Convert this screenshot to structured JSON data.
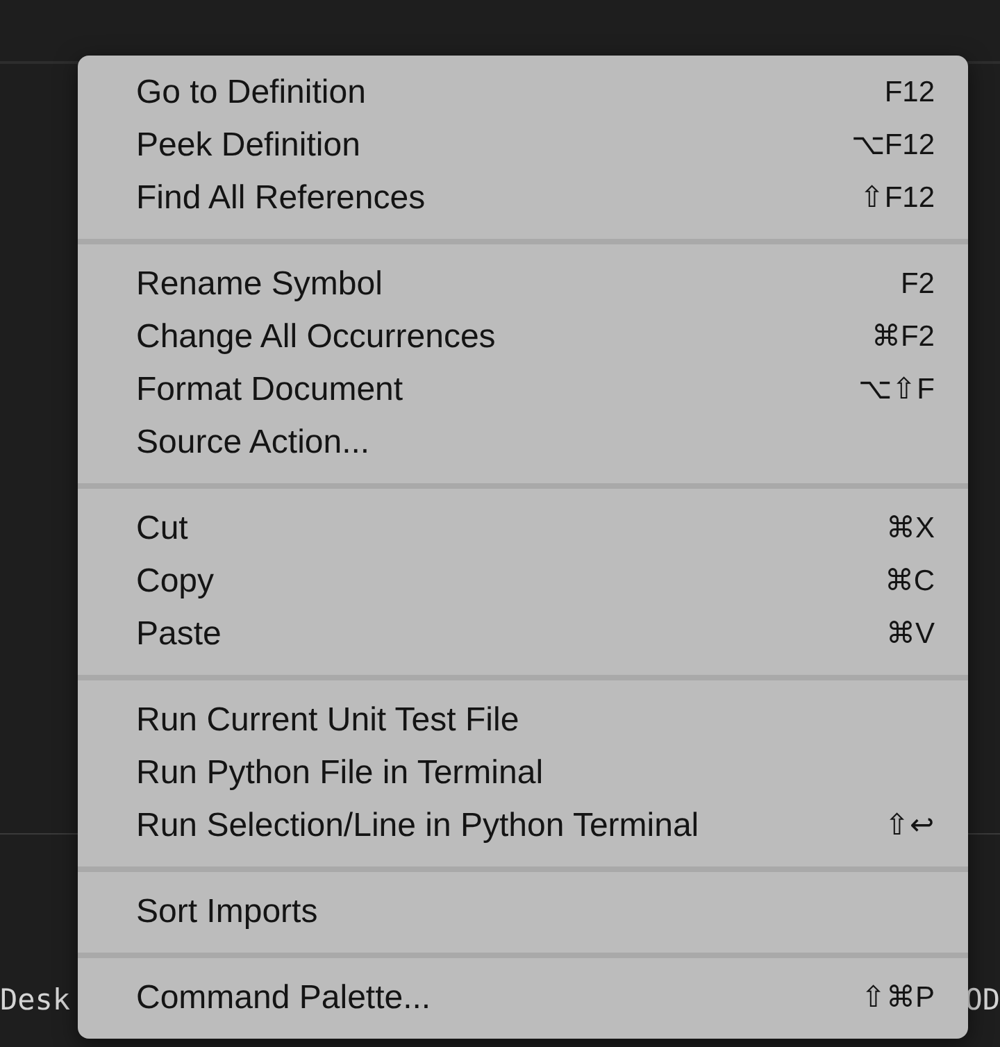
{
  "menu_groups": [
    {
      "items": [
        {
          "label": "Go to Definition",
          "shortcut": "F12"
        },
        {
          "label": "Peek Definition",
          "shortcut": "⌥F12"
        },
        {
          "label": "Find All References",
          "shortcut": "⇧F12"
        }
      ]
    },
    {
      "items": [
        {
          "label": "Rename Symbol",
          "shortcut": "F2"
        },
        {
          "label": "Change All Occurrences",
          "shortcut": "⌘F2"
        },
        {
          "label": "Format Document",
          "shortcut": "⌥⇧F"
        },
        {
          "label": "Source Action..."
        }
      ]
    },
    {
      "items": [
        {
          "label": "Cut",
          "shortcut": "⌘X"
        },
        {
          "label": "Copy",
          "shortcut": "⌘C"
        },
        {
          "label": "Paste",
          "shortcut": "⌘V"
        }
      ]
    },
    {
      "items": [
        {
          "label": "Run Current Unit Test File"
        },
        {
          "label": "Run Python File in Terminal"
        },
        {
          "label": "Run Selection/Line in Python Terminal",
          "shortcut": "⇧↩"
        }
      ]
    },
    {
      "items": [
        {
          "label": "Sort Imports"
        }
      ]
    },
    {
      "items": [
        {
          "label": "Command Palette...",
          "shortcut": "⇧⌘P"
        }
      ]
    }
  ],
  "terminal": {
    "lines": [
      {
        "left": "Desk",
        "right": "OD"
      }
    ]
  }
}
